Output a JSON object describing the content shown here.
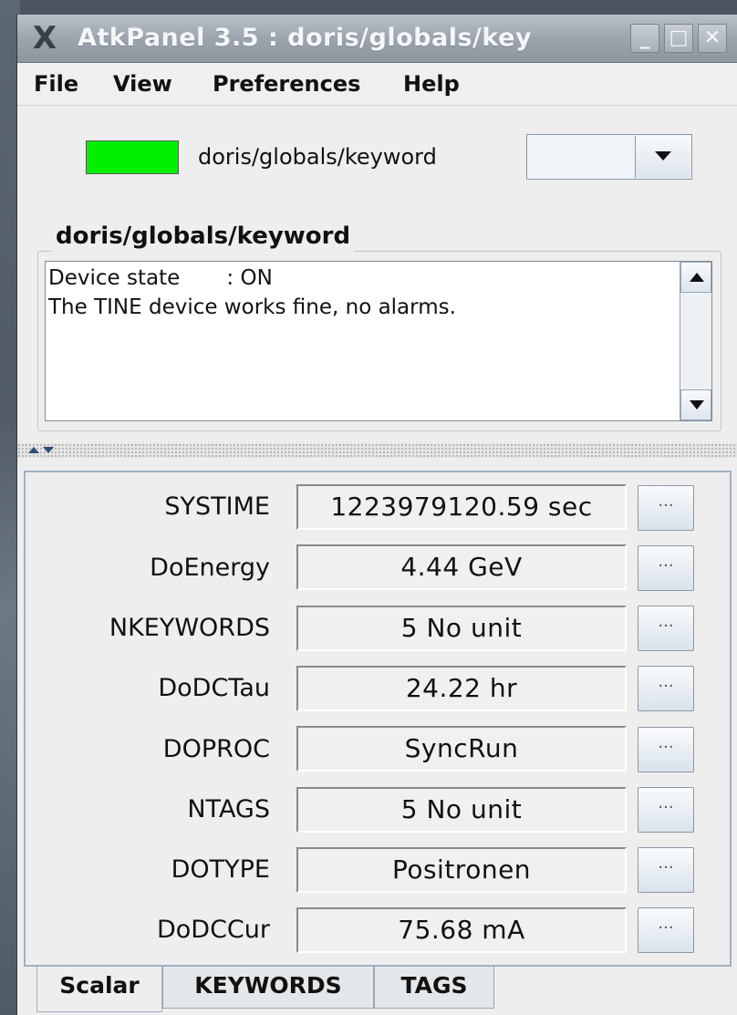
{
  "window": {
    "title": "AtkPanel  3.5  : doris/globals/key",
    "controls": {
      "minimize": "_",
      "maximize": "□",
      "close": "✕"
    }
  },
  "menu": [
    "File",
    "View",
    "Preferences",
    "Help"
  ],
  "header": {
    "state_color": "#00f000",
    "device_name": "doris/globals/keyword",
    "combo_value": ""
  },
  "status_group": {
    "title": "doris/globals/keyword",
    "lines": [
      "Device state       : ON",
      "The TINE device works fine, no alarms."
    ]
  },
  "attributes": [
    {
      "name": "SYSTIME",
      "value": "1223979120.59 sec"
    },
    {
      "name": "DoEnergy",
      "value": "4.44 GeV"
    },
    {
      "name": "NKEYWORDS",
      "value": "5 No unit"
    },
    {
      "name": "DoDCTau",
      "value": "24.22 hr"
    },
    {
      "name": "DOPROC",
      "value": "SyncRun"
    },
    {
      "name": "NTAGS",
      "value": "5 No unit"
    },
    {
      "name": "DOTYPE",
      "value": "Positronen"
    },
    {
      "name": "DoDCCur",
      "value": "75.68 mA"
    }
  ],
  "more_button_label": "···",
  "tabs": [
    {
      "label": "Scalar",
      "selected": true
    },
    {
      "label": "KEYWORDS",
      "selected": false
    },
    {
      "label": "TAGS",
      "selected": false
    }
  ]
}
